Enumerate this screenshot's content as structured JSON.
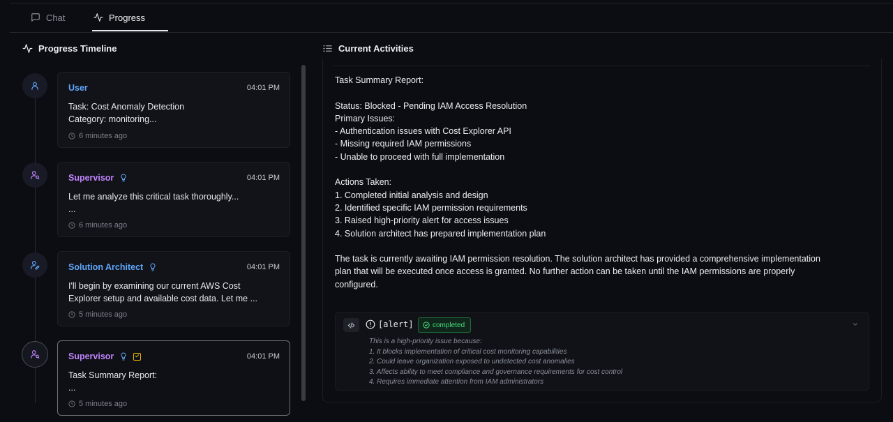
{
  "tabs": [
    {
      "label": "Chat",
      "icon": "chat-bubble-icon"
    },
    {
      "label": "Progress",
      "icon": "activity-icon"
    }
  ],
  "timeline": {
    "title": "Progress Timeline",
    "items": [
      {
        "role": "User",
        "time": "04:01 PM",
        "lines": [
          "Task: Cost Anomaly Detection",
          "Category: monitoring..."
        ],
        "ago": "6 minutes ago"
      },
      {
        "role": "Supervisor",
        "time": "04:01 PM",
        "lines": [
          "Let me analyze this critical task thoroughly...",
          "..."
        ],
        "ago": "6 minutes ago"
      },
      {
        "role": "Solution Architect",
        "time": "04:01 PM",
        "lines": [
          "I'll begin by examining our current AWS Cost",
          "Explorer setup and available cost data. Let me ..."
        ],
        "ago": "5 minutes ago"
      },
      {
        "role": "Supervisor",
        "time": "04:01 PM",
        "lines": [
          "Task Summary Report:",
          "..."
        ],
        "ago": "5 minutes ago"
      }
    ]
  },
  "activities": {
    "title": "Current Activities",
    "report_lines": [
      "Task Summary Report:",
      "",
      "Status: Blocked - Pending IAM Access Resolution",
      "Primary Issues:",
      "- Authentication issues with Cost Explorer API",
      "- Missing required IAM permissions",
      "- Unable to proceed with full implementation",
      "",
      "Actions Taken:",
      "1. Completed initial analysis and design",
      "2. Identified specific IAM permission requirements",
      "3. Raised high-priority alert for access issues",
      "4. Solution architect has prepared implementation plan",
      "",
      "The task is currently awaiting IAM permission resolution. The solution architect has provided a comprehensive implementation",
      "plan that will be executed once access is granted. No further action can be taken until the IAM permissions are properly",
      "configured."
    ],
    "alert": {
      "tag": "[alert]",
      "status": "completed",
      "detail_lines": [
        "This is a high-priority issue because:",
        "1. It blocks implementation of critical cost monitoring capabilities",
        "2. Could leave organization exposed to undetected cost anomalies",
        "3. Affects ability to meet compliance and governance requirements for cost control",
        "4. Requires immediate attention from IAM administrators"
      ]
    }
  }
}
